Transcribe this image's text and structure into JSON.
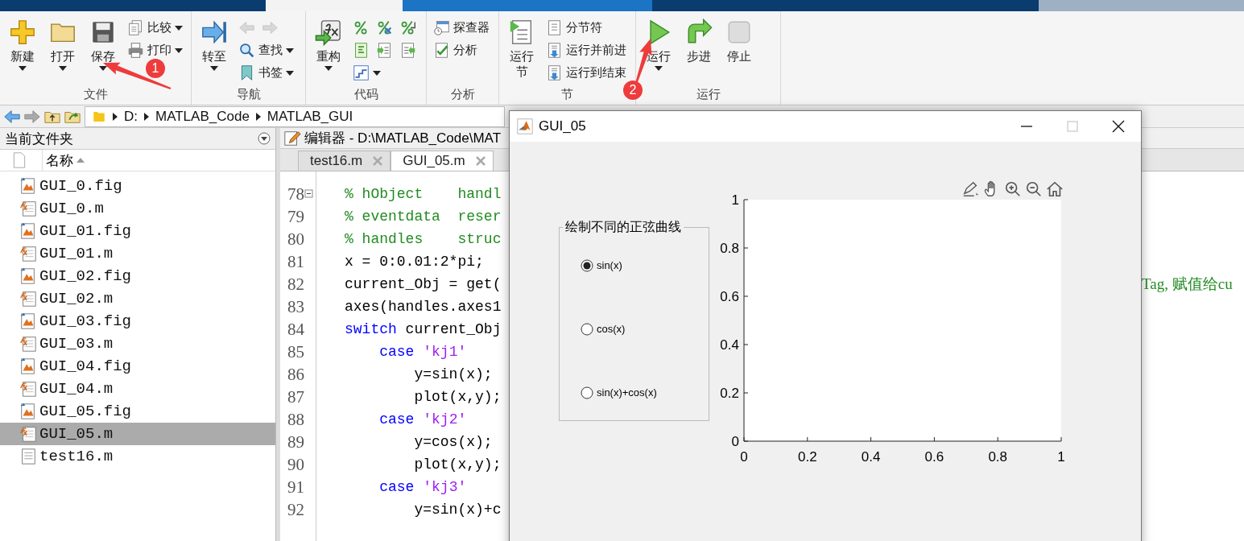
{
  "ribbon": {
    "groups": [
      {
        "label": "文件",
        "items": [
          {
            "kind": "large",
            "label": "新建",
            "dropdown": true
          },
          {
            "kind": "large",
            "label": "打开",
            "dropdown": true
          },
          {
            "kind": "large",
            "label": "保存",
            "dropdown": true
          },
          {
            "kind": "column",
            "rows": [
              [
                {
                  "label": "比较",
                  "dropdown": true
                }
              ],
              [
                {
                  "label": "打印",
                  "dropdown": true
                }
              ]
            ]
          }
        ]
      },
      {
        "label": "导航",
        "items": [
          {
            "kind": "large",
            "label": "转至",
            "dropdown": true
          },
          {
            "kind": "column",
            "rows": [
              [
                {
                  "disabled": true
                },
                {
                  "disabled": true
                }
              ],
              [
                {
                  "label": "查找",
                  "dropdown": true
                }
              ],
              [
                {
                  "label": "书签",
                  "dropdown": true
                }
              ]
            ]
          }
        ]
      },
      {
        "label": "代码",
        "items": [
          {
            "kind": "large",
            "label": "重构",
            "dropdown": true
          },
          {
            "kind": "column",
            "rows": [
              [
                {
                  "dropdown": false
                },
                {
                  "dropdown": false
                },
                {
                  "dropdown": false
                }
              ],
              [
                {
                  "dropdown": false
                },
                {
                  "dropdown": false
                },
                {
                  "dropdown": false
                }
              ],
              [
                {
                  "dropdown": true
                }
              ]
            ]
          }
        ]
      },
      {
        "label": "分析",
        "items": [
          {
            "kind": "column",
            "rows": [
              [
                {
                  "label": "探查器",
                  "dropdown": false
                }
              ],
              [
                {
                  "label": "分析",
                  "dropdown": false
                }
              ]
            ]
          }
        ]
      },
      {
        "label": "节",
        "items": [
          {
            "kind": "large",
            "label": "运行节",
            "dropdown": false
          },
          {
            "kind": "column",
            "rows": [
              [
                {
                  "label": "分节符",
                  "dropdown": false
                }
              ],
              [
                {
                  "label": "运行并前进",
                  "dropdown": false
                }
              ],
              [
                {
                  "label": "运行到结束",
                  "dropdown": false
                }
              ]
            ]
          }
        ]
      },
      {
        "label": "运行",
        "items": [
          {
            "kind": "large",
            "label": "运行",
            "dropdown": true
          },
          {
            "kind": "large",
            "label": "步进",
            "dropdown": false
          },
          {
            "kind": "large",
            "label": "停止",
            "dropdown": false
          }
        ]
      }
    ]
  },
  "annotations": [
    {
      "label": "1"
    },
    {
      "label": "2"
    }
  ],
  "address": {
    "path": [
      "D:",
      "MATLAB_Code",
      "MATLAB_GUI"
    ]
  },
  "file_browser": {
    "title": "当前文件夹",
    "column": "名称",
    "files": [
      {
        "name": "GUI_0.fig",
        "kind": "fig",
        "selected": false
      },
      {
        "name": "GUI_0.m",
        "kind": "m",
        "selected": false
      },
      {
        "name": "GUI_01.fig",
        "kind": "fig",
        "selected": false
      },
      {
        "name": "GUI_01.m",
        "kind": "m",
        "selected": false
      },
      {
        "name": "GUI_02.fig",
        "kind": "fig",
        "selected": false
      },
      {
        "name": "GUI_02.m",
        "kind": "m",
        "selected": false
      },
      {
        "name": "GUI_03.fig",
        "kind": "fig",
        "selected": false
      },
      {
        "name": "GUI_03.m",
        "kind": "m",
        "selected": false
      },
      {
        "name": "GUI_04.fig",
        "kind": "fig",
        "selected": false
      },
      {
        "name": "GUI_04.m",
        "kind": "m",
        "selected": false
      },
      {
        "name": "GUI_05.fig",
        "kind": "fig",
        "selected": false
      },
      {
        "name": "GUI_05.m",
        "kind": "m",
        "selected": true
      },
      {
        "name": "test16.m",
        "kind": "script",
        "selected": false
      }
    ]
  },
  "editor": {
    "title": "编辑器 - D:\\MATLAB_Code\\MAT",
    "tabs": [
      {
        "label": "test16.m",
        "selected": false
      },
      {
        "label": "GUI_05.m",
        "selected": true
      }
    ],
    "lines": [
      {
        "number": "78",
        "fold": true,
        "segments": [
          {
            "kind": "comment",
            "text": "% hObject    handl"
          }
        ]
      },
      {
        "number": "79",
        "fold": false,
        "segments": [
          {
            "kind": "comment",
            "text": "% eventdata  reser"
          }
        ]
      },
      {
        "number": "80",
        "fold": false,
        "segments": [
          {
            "kind": "comment",
            "text": "% handles    struc"
          }
        ]
      },
      {
        "number": "81",
        "fold": false,
        "segments": [
          {
            "kind": "plain",
            "text": "x = 0:0.01:2*pi;"
          }
        ]
      },
      {
        "number": "82",
        "fold": false,
        "segments": [
          {
            "kind": "plain",
            "text": "current_Obj = get("
          }
        ],
        "tail": "Tag, 赋值给cu"
      },
      {
        "number": "83",
        "fold": false,
        "segments": [
          {
            "kind": "plain",
            "text": "axes(handles.axes1"
          }
        ]
      },
      {
        "number": "84",
        "fold": false,
        "segments": [
          {
            "kind": "keyword",
            "text": "switch"
          },
          {
            "kind": "plain",
            "text": " current_Obj"
          }
        ]
      },
      {
        "number": "85",
        "fold": false,
        "segments": [
          {
            "kind": "keyword",
            "text": "    case"
          },
          {
            "kind": "string",
            "text": " 'kj1'"
          }
        ]
      },
      {
        "number": "86",
        "fold": false,
        "segments": [
          {
            "kind": "plain",
            "text": "        y=sin(x);"
          }
        ]
      },
      {
        "number": "87",
        "fold": false,
        "segments": [
          {
            "kind": "plain",
            "text": "        plot(x,y);"
          }
        ]
      },
      {
        "number": "88",
        "fold": false,
        "segments": [
          {
            "kind": "keyword",
            "text": "    case"
          },
          {
            "kind": "string",
            "text": " 'kj2'"
          }
        ]
      },
      {
        "number": "89",
        "fold": false,
        "segments": [
          {
            "kind": "plain",
            "text": "        y=cos(x);"
          }
        ]
      },
      {
        "number": "90",
        "fold": false,
        "segments": [
          {
            "kind": "plain",
            "text": "        plot(x,y);"
          }
        ]
      },
      {
        "number": "91",
        "fold": false,
        "segments": [
          {
            "kind": "keyword",
            "text": "    case"
          },
          {
            "kind": "string",
            "text": " 'kj3'"
          }
        ]
      },
      {
        "number": "92",
        "fold": false,
        "segments": [
          {
            "kind": "plain",
            "text": "        y=sin(x)+c"
          }
        ]
      }
    ]
  },
  "figure": {
    "title": "GUI_05",
    "panel": {
      "title": "绘制不同的正弦曲线",
      "options": [
        {
          "label": "sin(x)",
          "selected": true
        },
        {
          "label": "cos(x)",
          "selected": false
        },
        {
          "label": "sin(x)+cos(x)",
          "selected": false
        }
      ]
    },
    "axes": {
      "chart_data": {
        "type": "line",
        "xlim": [
          0,
          1
        ],
        "ylim": [
          0,
          1
        ],
        "xticks": [
          0,
          0.2,
          0.4,
          0.6,
          0.8,
          1
        ],
        "yticks": [
          0,
          0.2,
          0.4,
          0.6,
          0.8,
          1
        ]
      }
    }
  }
}
